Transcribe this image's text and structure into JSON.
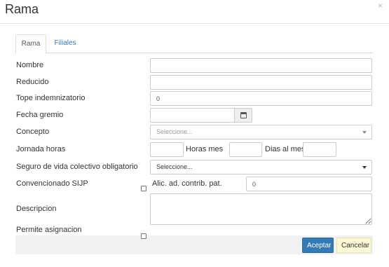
{
  "modal": {
    "title": "Rama",
    "close": "×"
  },
  "tabs": [
    {
      "label": "Rama",
      "active": true
    },
    {
      "label": "Filiales",
      "active": false
    }
  ],
  "form": {
    "nombre": {
      "label": "Nombre",
      "value": ""
    },
    "reducido": {
      "label": "Reducido",
      "value": ""
    },
    "tope": {
      "label": "Tope indemnizatorio",
      "value": "0"
    },
    "fecha_gremio": {
      "label": "Fecha gremio",
      "value": ""
    },
    "concepto": {
      "label": "Concepto",
      "placeholder": "Seleccione..."
    },
    "jornada": {
      "label": "Jornada horas",
      "horas_mes_label": "Horas mes",
      "dias_al_mes_label": "Dias al mes",
      "horas": "",
      "horas_mes": "",
      "dias_al_mes": ""
    },
    "seguro": {
      "label": "Seguro de vida colectivo obligatorio",
      "selected": "Seleccione..."
    },
    "convencionado": {
      "label": "Convencionado SIJP",
      "checked": false
    },
    "alic": {
      "label": "Alic. ad. contrib. pat.",
      "value": "0"
    },
    "descripcion": {
      "label": "Descripcion",
      "value": ""
    },
    "permite": {
      "label": "Permite asignacion",
      "checked": false
    }
  },
  "footer": {
    "accept_label": "Aceptar",
    "cancel_label": "Cancelar"
  },
  "colors": {
    "primary": "#337ab7",
    "cancel_bg": "#fcf8d4",
    "link": "#337ab7"
  }
}
